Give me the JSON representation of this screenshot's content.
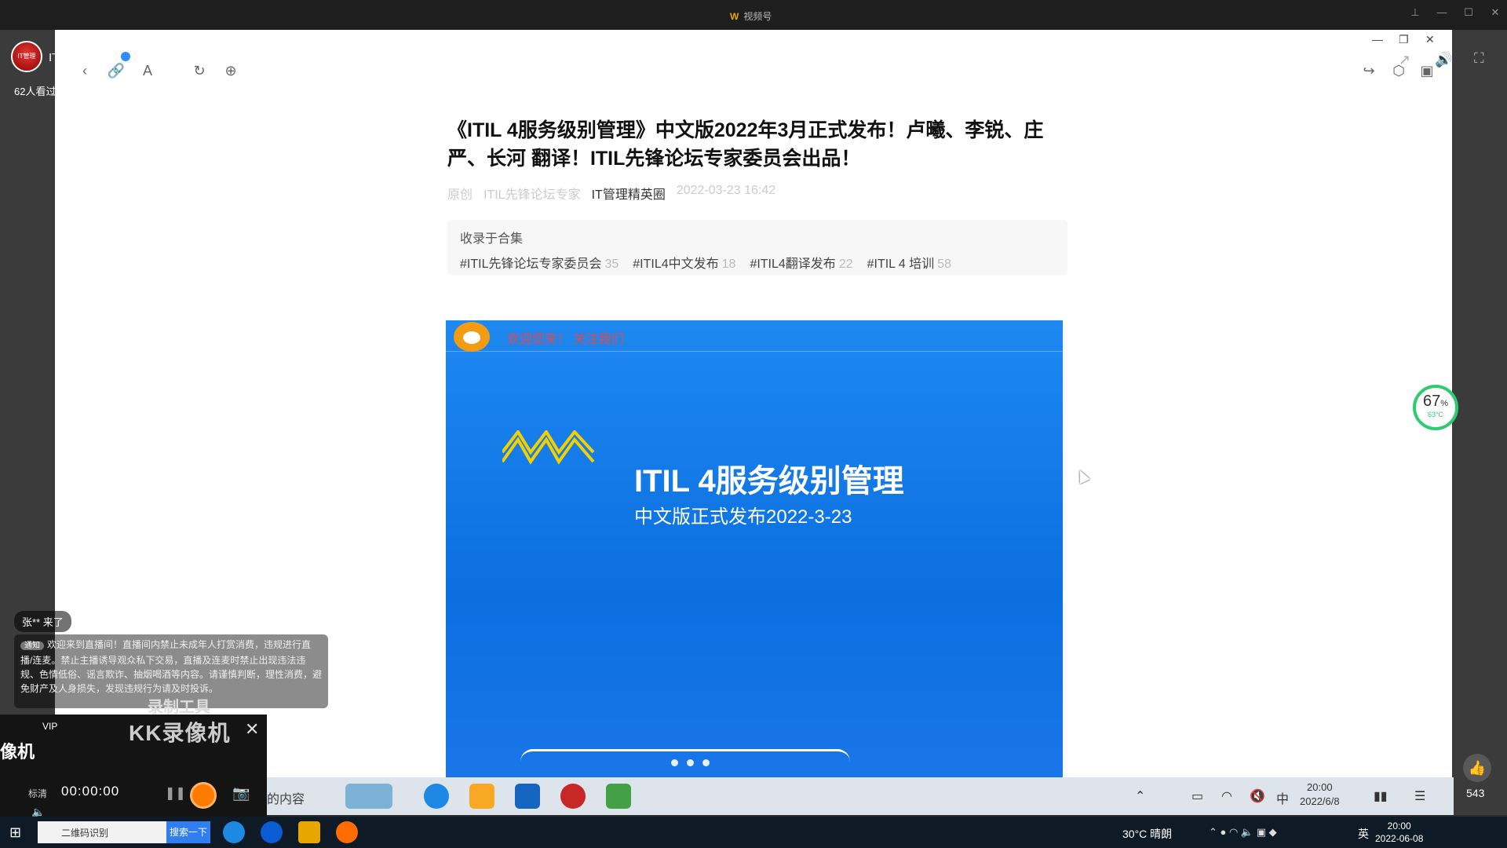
{
  "app": {
    "title": "视频号"
  },
  "streamer": {
    "name": "IT管理精英圈",
    "avatar_text": "IT管理",
    "viewers": "62人看过"
  },
  "article": {
    "title": "《ITIL 4服务级别管理》中文版2022年3月正式发布！卢曦、李锐、庄严、长河 翻译！ITIL先锋论坛专家委员会出品！",
    "meta_original": "原创",
    "meta_org": "ITIL先锋论坛专家",
    "meta_author": "IT管理精英圈",
    "meta_date": "2022-03-23 16:42",
    "collection_label": "收录于合集",
    "tags": [
      {
        "name": "#ITIL先锋论坛专家委员会",
        "count": "35"
      },
      {
        "name": "#ITIL4中文发布",
        "count": "18"
      },
      {
        "name": "#ITIL4翻译发布",
        "count": "22"
      },
      {
        "name": "#ITIL 4 培训",
        "count": "58"
      }
    ]
  },
  "hero": {
    "label": "欢迎您来！ 关注我们",
    "title": "ITIL 4服务级别管理",
    "subtitle": "中文版正式发布2022-3-23"
  },
  "gauge": {
    "percent": "67",
    "percent_unit": "%",
    "temp": "63°C"
  },
  "likes": "543",
  "chat": {
    "join": "张** 来了",
    "notice_tag": "通知",
    "notice": "欢迎来到直播间！直播间内禁止未成年人打赏消费，违规进行直播/连麦。禁止主播诱导观众私下交易，直播及连麦时禁止出现违法违规、色情低俗、谣言欺诈、抽烟喝酒等内容。请谨慎判断，理性消费，避免财产及人身损失，发现违规行为请及时投诉。"
  },
  "record_tool": "录制工具",
  "kk": {
    "vip": "VIP",
    "brand": "KK录像机",
    "machine": "像机",
    "quality": "标清",
    "time": "00:00:00"
  },
  "inner_taskbar": {
    "content_label": "的内容",
    "time": "20:00",
    "date": "2022/6/8"
  },
  "taskbar": {
    "search_value": "二维码识别",
    "search_button": "搜索一下",
    "weather": "30°C 晴朗",
    "lang": "英",
    "time": "20:00",
    "date": "2022-06-08"
  }
}
